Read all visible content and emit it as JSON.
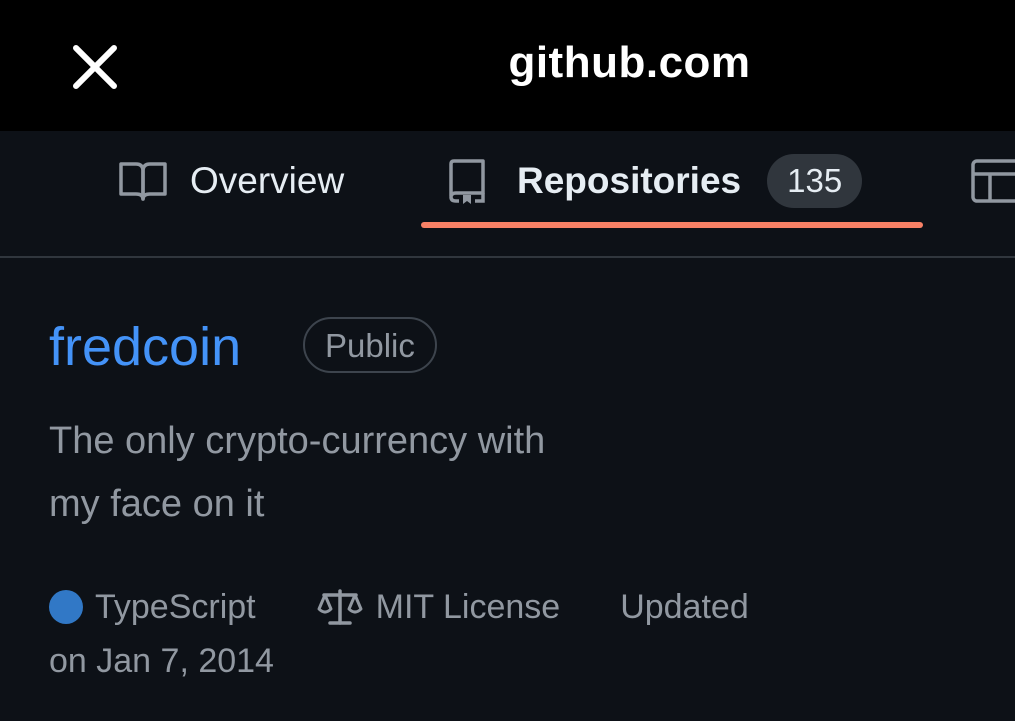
{
  "topbar": {
    "close_icon": "close-icon",
    "title": "github.com"
  },
  "tabs": [
    {
      "label": "Overview",
      "icon": "book-icon"
    },
    {
      "label": "Repositories",
      "icon": "repo-icon",
      "count": "135",
      "selected": true
    },
    {
      "label": "",
      "icon": "table-icon"
    }
  ],
  "repo": {
    "name": "fredcoin",
    "visibility": "Public",
    "description_line1": "The only crypto-currency with",
    "description_line2": "my face on it",
    "language": "TypeScript",
    "language_color": "#3178c6",
    "license": "MIT License",
    "updated_prefix": "Updated",
    "updated_date": "on Jan 7, 2014"
  },
  "colors": {
    "accent_underline": "#f78166",
    "link": "#4493f8",
    "background": "#0d1117"
  }
}
